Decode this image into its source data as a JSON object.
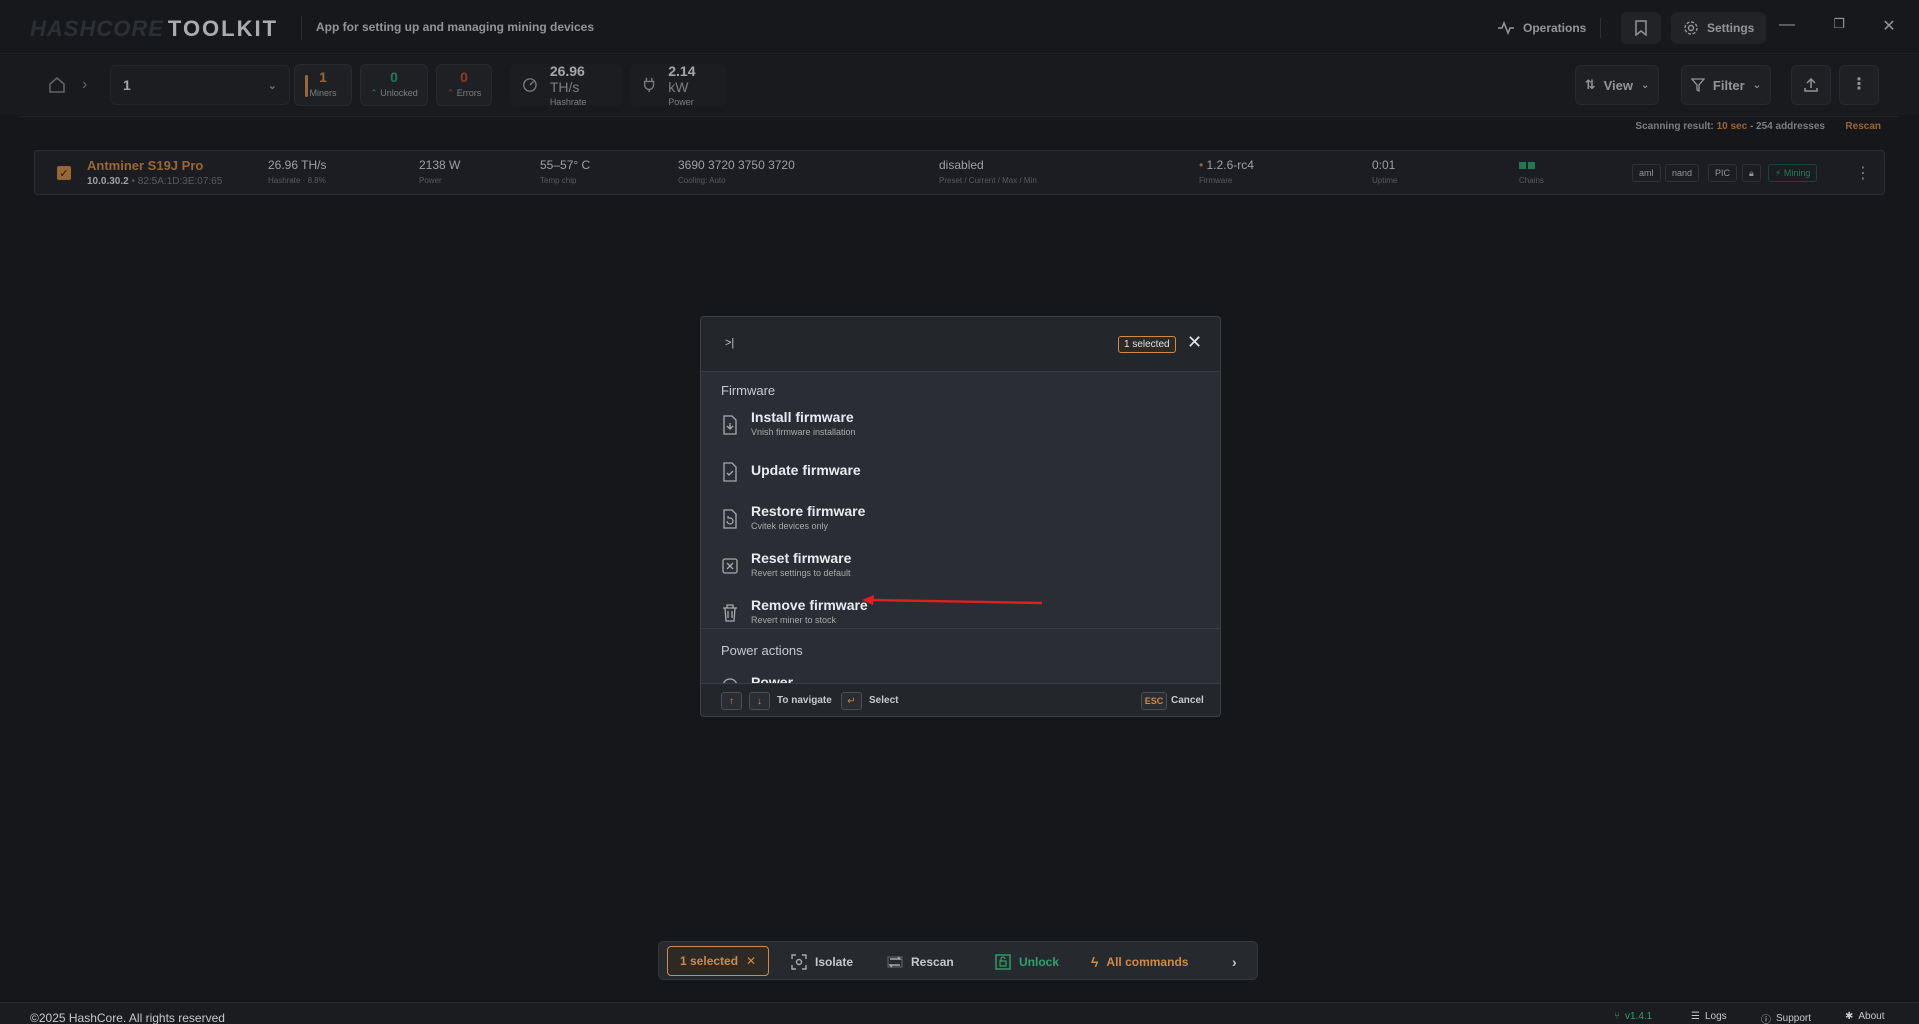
{
  "app": {
    "logo_main": "HASHCORE",
    "logo_tool": "TOOLKIT",
    "tagline": "App for setting up and managing mining devices",
    "operations_label": "Operations",
    "settings_label": "Settings"
  },
  "toolbar": {
    "group_value": "1",
    "stats": [
      {
        "value": "1",
        "label": "Miners"
      },
      {
        "value": "0",
        "label": "Unlocked"
      },
      {
        "value": "0",
        "label": "Errors"
      }
    ],
    "hashrate": {
      "value": "26.96",
      "unit": "TH/s",
      "label": "Hashrate"
    },
    "power": {
      "value": "2.14",
      "unit": "kW",
      "label": "Power"
    },
    "view_label": "View",
    "filter_label": "Filter"
  },
  "scan": {
    "prefix": "Scanning result:",
    "highlight": "10 sec",
    "suffix": "- 254 addresses",
    "rescan_label": "Rescan"
  },
  "miner_row": {
    "model": "Antminer S19J Pro",
    "ip": "10.0.30.2",
    "mac": "• 82:5A:1D:3E:07:65",
    "hashrate": "26.96 TH/s",
    "hashrate_sub": "Hashrate · 8.8%",
    "power": "2138 W",
    "power_sub": "Power",
    "temp": "55–57° C",
    "temp_sub": "Temp chip",
    "fans": "3690 3720 3750 3720",
    "fans_sub": "Cooling: Auto",
    "preset": "disabled",
    "preset_sub": "Preset / Current / Max / Min",
    "firmware": "1.2.6-rc4",
    "firmware_sub": "Firmware",
    "uptime": "0:01",
    "uptime_sub": "Uptime",
    "chains_sub": "Chains",
    "tags": [
      "aml",
      "nand",
      "PIC"
    ],
    "status": "Mining"
  },
  "modal": {
    "selected_badge": "1 selected",
    "section_firmware": "Firmware",
    "items": [
      {
        "title": "Install firmware",
        "desc": "Vnish firmware installation"
      },
      {
        "title": "Update firmware",
        "desc": ""
      },
      {
        "title": "Restore firmware",
        "desc": "Cvitek devices only"
      },
      {
        "title": "Reset firmware",
        "desc": "Revert settings to default"
      },
      {
        "title": "Remove firmware",
        "desc": "Revert miner to stock"
      }
    ],
    "section_power": "Power actions",
    "power_partial": "Power",
    "footer": {
      "navigate_label": "To navigate",
      "select_label": "Select",
      "esc_key": "ESC",
      "cancel_label": "Cancel"
    }
  },
  "action_bar": {
    "selected": "1 selected",
    "isolate": "Isolate",
    "rescan": "Rescan",
    "unlock": "Unlock",
    "all_commands": "All commands"
  },
  "footer": {
    "copyright": "©2025 HashCore. All rights reserved",
    "version": "v1.4.1",
    "logs": "Logs",
    "support": "Support",
    "about": "About"
  },
  "colors": {
    "accent": "#d08a45",
    "green": "#2fa36b",
    "red": "#c84a3a",
    "annotation_arrow": "#e02020"
  }
}
